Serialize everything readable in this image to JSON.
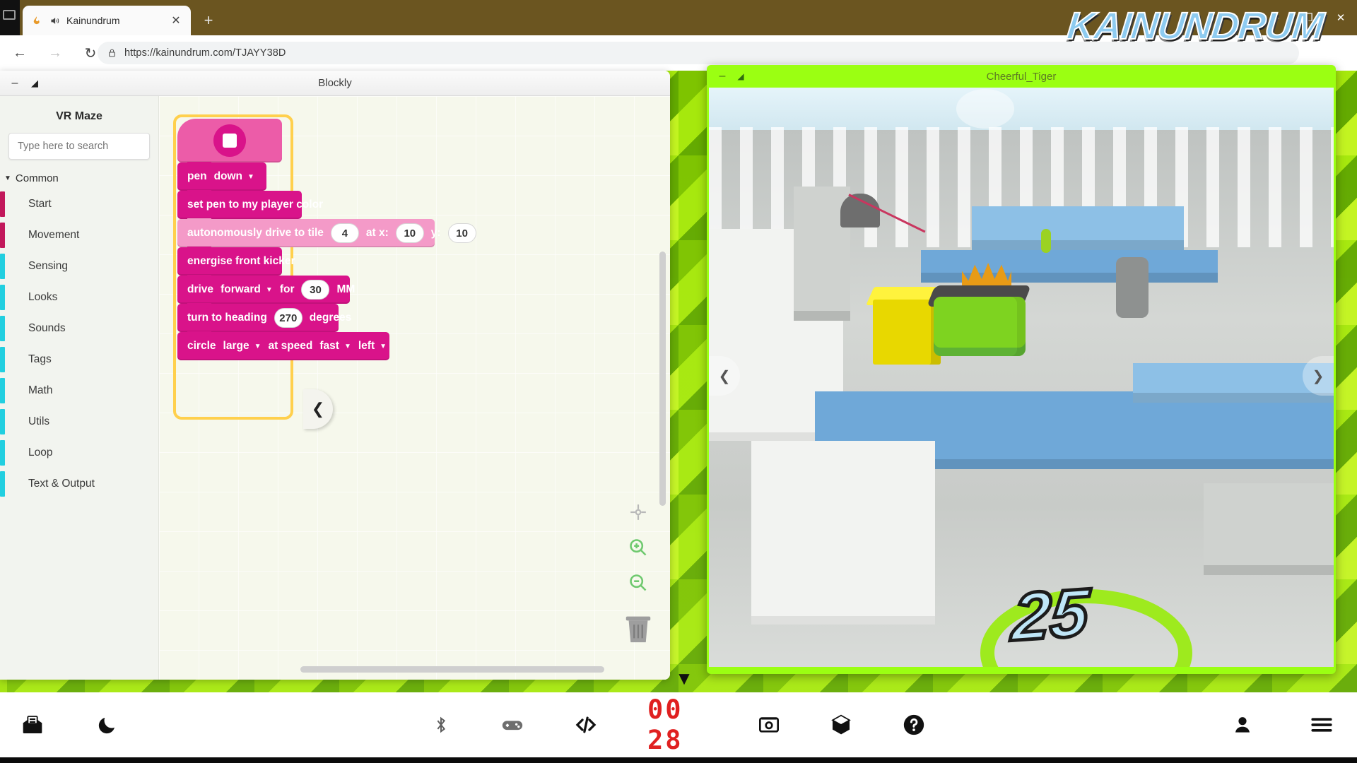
{
  "browser": {
    "tab": {
      "title": "Kainundrum",
      "favicon_icon": "flame-icon",
      "audio_icon": "speaker-icon",
      "close_icon": "close-icon"
    },
    "new_tab_icon": "plus-icon",
    "nav": {
      "back_icon": "back-arrow-icon",
      "forward_icon": "forward-arrow-icon",
      "reload_icon": "reload-icon"
    },
    "omnibox": {
      "lock_icon": "lock-icon",
      "url": "https://kainundrum.com/TJAYY38D"
    },
    "menu_icon": "three-dots-icon",
    "window_controls": {
      "minimize": "–",
      "restore": "❐",
      "close": "✕"
    }
  },
  "site": {
    "logo_text": "KAINUNDRUM",
    "logo_color": "#8ecbf0"
  },
  "blockly_window": {
    "title": "Blockly",
    "minimize_icon": "minimize-icon",
    "popout_icon": "popout-icon",
    "toolbox": {
      "title": "VR Maze",
      "search_placeholder": "Type here to search",
      "search_value": "",
      "group_label": "Common",
      "group_caret_icon": "caret-down-icon",
      "items": [
        {
          "label": "Start",
          "color": "#c2185b"
        },
        {
          "label": "Movement",
          "color": "#c2185b"
        },
        {
          "label": "Sensing",
          "color": "#22cfe0"
        },
        {
          "label": "Looks",
          "color": "#22cfe0"
        },
        {
          "label": "Sounds",
          "color": "#22cfe0"
        },
        {
          "label": "Tags",
          "color": "#22cfe0"
        },
        {
          "label": "Math",
          "color": "#22cfe0"
        },
        {
          "label": "Utils",
          "color": "#22cfe0"
        },
        {
          "label": "Loop",
          "color": "#22cfe0"
        },
        {
          "label": "Text & Output",
          "color": "#22cfe0"
        }
      ]
    },
    "workspace": {
      "collapse_icon": "chevron-left-icon",
      "tools": [
        {
          "name": "center-target-icon"
        },
        {
          "name": "zoom-in-icon"
        },
        {
          "name": "zoom-out-icon"
        }
      ],
      "trash_icon": "trash-icon",
      "blocks": {
        "hat": {
          "icon": "stop-button-icon",
          "color": "#ec5ca8"
        },
        "rows": [
          {
            "id": "pen",
            "highlight": false,
            "parts": [
              {
                "type": "label",
                "text": "pen"
              },
              {
                "type": "dropdown",
                "text": "down"
              }
            ]
          },
          {
            "id": "set-pen-color",
            "highlight": false,
            "parts": [
              {
                "type": "label",
                "text": "set pen to my player color"
              }
            ]
          },
          {
            "id": "drive-to-tile",
            "highlight": true,
            "parts": [
              {
                "type": "label",
                "text": "autonomously drive to tile"
              },
              {
                "type": "field",
                "text": "4"
              },
              {
                "type": "label",
                "text": "at x:"
              },
              {
                "type": "field",
                "text": "10"
              },
              {
                "type": "label",
                "text": "y:"
              },
              {
                "type": "field",
                "text": "10"
              }
            ]
          },
          {
            "id": "energise-kicker",
            "highlight": false,
            "parts": [
              {
                "type": "label",
                "text": "energise front kicker"
              }
            ]
          },
          {
            "id": "drive-forward",
            "highlight": false,
            "parts": [
              {
                "type": "label",
                "text": "drive"
              },
              {
                "type": "dropdown",
                "text": "forward"
              },
              {
                "type": "label",
                "text": "for"
              },
              {
                "type": "field",
                "text": "30"
              },
              {
                "type": "label",
                "text": "MM"
              }
            ]
          },
          {
            "id": "turn-heading",
            "highlight": false,
            "parts": [
              {
                "type": "label",
                "text": "turn to heading"
              },
              {
                "type": "field",
                "text": "270"
              },
              {
                "type": "label",
                "text": "degrees"
              }
            ]
          },
          {
            "id": "circle",
            "highlight": false,
            "parts": [
              {
                "type": "label",
                "text": "circle"
              },
              {
                "type": "dropdown",
                "text": "large"
              },
              {
                "type": "label",
                "text": "at speed"
              },
              {
                "type": "dropdown",
                "text": "fast"
              },
              {
                "type": "dropdown",
                "text": "left"
              }
            ]
          }
        ]
      }
    }
  },
  "game_window": {
    "title": "Cheerful_Tiger",
    "minimize_icon": "minimize-icon",
    "popout_icon": "popout-icon",
    "floor_number": "25",
    "prev_icon": "chevron-left-icon",
    "next_icon": "chevron-right-icon"
  },
  "page_collapse_icon": "chevron-down-icon",
  "toolbar": {
    "left": [
      {
        "name": "inbox-icon"
      },
      {
        "name": "moon-icon"
      }
    ],
    "center": [
      {
        "name": "bluetooth-icon"
      },
      {
        "name": "gamepad-icon"
      },
      {
        "name": "code-icon"
      }
    ],
    "timer": "00 28",
    "timer_color": "#e02020",
    "center_after": [
      {
        "name": "screenshot-icon"
      },
      {
        "name": "cube-icon"
      },
      {
        "name": "help-icon"
      }
    ],
    "right": [
      {
        "name": "account-icon"
      },
      {
        "name": "hamburger-menu-icon"
      }
    ]
  }
}
